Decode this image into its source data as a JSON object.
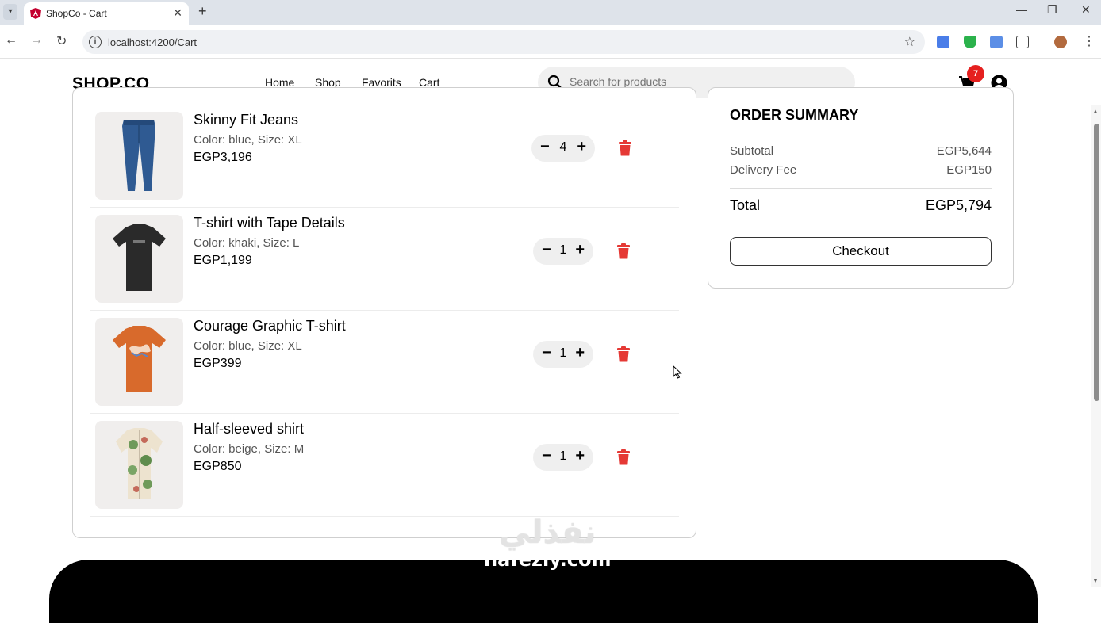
{
  "browser": {
    "tab_title": "ShopCo - Cart",
    "url": "localhost:4200/Cart",
    "window_controls": [
      "—",
      "❐",
      "✕"
    ]
  },
  "site": {
    "logo": "SHOP.CO",
    "nav": [
      "Home",
      "Shop",
      "Favorits",
      "Cart"
    ],
    "active_nav": "Cart",
    "search_placeholder": "Search for products",
    "cart_count": "7"
  },
  "cart": {
    "items": [
      {
        "name": "Skinny Fit Jeans",
        "meta": "Color: blue, Size: XL",
        "price": "EGP3,196",
        "qty": "4",
        "image": "jeans"
      },
      {
        "name": "T-shirt with Tape Details",
        "meta": "Color: khaki, Size: L",
        "price": "EGP1,199",
        "qty": "1",
        "image": "black-tshirt"
      },
      {
        "name": "Courage Graphic T-shirt",
        "meta": "Color: blue, Size: XL",
        "price": "EGP399",
        "qty": "1",
        "image": "orange-tshirt"
      },
      {
        "name": "Half-sleeved shirt",
        "meta": "Color: beige, Size: M",
        "price": "EGP850",
        "qty": "1",
        "image": "floral-shirt"
      }
    ]
  },
  "summary": {
    "title": "ORDER SUMMARY",
    "subtotal_label": "Subtotal",
    "subtotal_value": "EGP5,644",
    "delivery_label": "Delivery Fee",
    "delivery_value": "EGP150",
    "total_label": "Total",
    "total_value": "EGP5,794",
    "checkout_label": "Checkout"
  },
  "watermark": {
    "arabic": "نفذلي",
    "latin": "nafezly.com"
  },
  "colors": {
    "accent": "#000000",
    "badge": "#e5201f",
    "trash": "#e53935"
  }
}
